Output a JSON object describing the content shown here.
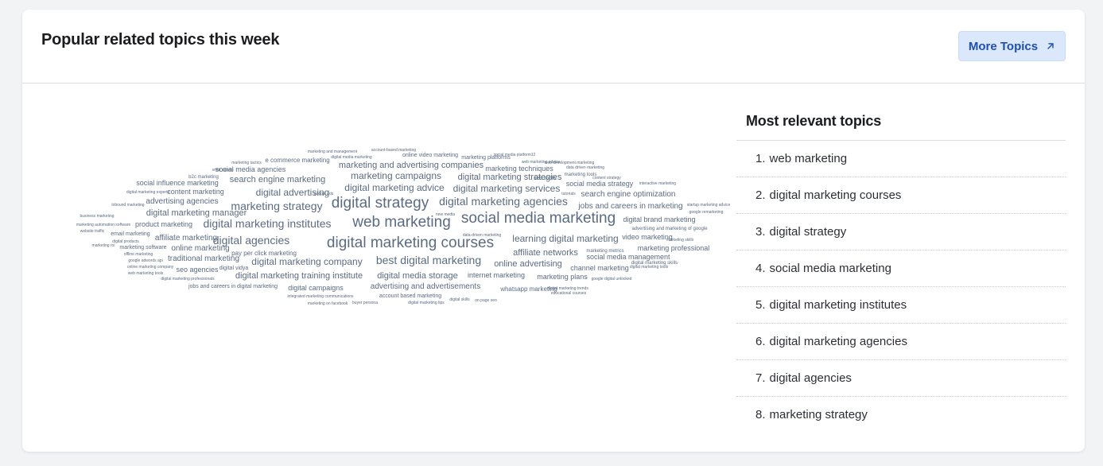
{
  "header": {
    "title": "Popular related topics this week",
    "more_button_label": "More Topics"
  },
  "cloud": {
    "color": "#5b6b82",
    "words": [
      {
        "text": "web marketing",
        "size": 19
      },
      {
        "text": "social media marketing",
        "size": 19
      },
      {
        "text": "digital strategy",
        "size": 19
      },
      {
        "text": "digital marketing courses",
        "size": 19
      },
      {
        "text": "digital marketing agencies",
        "size": 14
      },
      {
        "text": "marketing strategy",
        "size": 14
      },
      {
        "text": "digital marketing institutes",
        "size": 14
      },
      {
        "text": "digital agencies",
        "size": 14
      },
      {
        "text": "best digital marketing",
        "size": 14
      },
      {
        "text": "learning digital marketing",
        "size": 12
      },
      {
        "text": "digital marketing company",
        "size": 12
      },
      {
        "text": "digital advertising",
        "size": 12
      },
      {
        "text": "digital marketing advice",
        "size": 12
      },
      {
        "text": "digital marketing services",
        "size": 12
      },
      {
        "text": "search engine marketing",
        "size": 11
      },
      {
        "text": "marketing campaigns",
        "size": 12
      },
      {
        "text": "digital marketing strategies",
        "size": 11
      },
      {
        "text": "marketing and advertising companies",
        "size": 11
      },
      {
        "text": "affiliate networks",
        "size": 11
      },
      {
        "text": "online advertising",
        "size": 11
      },
      {
        "text": "digital marketing manager",
        "size": 11
      },
      {
        "text": "advertising agencies",
        "size": 10
      },
      {
        "text": "digital media storage",
        "size": 11
      },
      {
        "text": "jobs and careers in marketing",
        "size": 10
      },
      {
        "text": "search engine optimization",
        "size": 10
      },
      {
        "text": "digital marketing training institute",
        "size": 11
      },
      {
        "text": "traditional marketing",
        "size": 10
      },
      {
        "text": "online marketing",
        "size": 10
      },
      {
        "text": "affiliate marketing",
        "size": 10
      },
      {
        "text": "social media agencies",
        "size": 9
      },
      {
        "text": "content marketing",
        "size": 9
      },
      {
        "text": "social influence marketing",
        "size": 9
      },
      {
        "text": "social media strategy",
        "size": 9
      },
      {
        "text": "advertising and advertisements",
        "size": 10
      },
      {
        "text": "internet marketing",
        "size": 9
      },
      {
        "text": "marketing techniques",
        "size": 9
      },
      {
        "text": "digital brand marketing",
        "size": 9
      },
      {
        "text": "video marketing",
        "size": 9
      },
      {
        "text": "marketing professional",
        "size": 9
      },
      {
        "text": "social media management",
        "size": 9
      },
      {
        "text": "channel marketing",
        "size": 9
      },
      {
        "text": "marketing plans",
        "size": 9
      },
      {
        "text": "digital campaigns",
        "size": 9
      },
      {
        "text": "product marketing",
        "size": 9
      },
      {
        "text": "e commerce marketing",
        "size": 8
      },
      {
        "text": "seo agencies",
        "size": 9
      },
      {
        "text": "pay per click marketing",
        "size": 8
      },
      {
        "text": "whatsapp marketing",
        "size": 8
      },
      {
        "text": "account based marketing",
        "size": 7
      },
      {
        "text": "online video marketing",
        "size": 7
      },
      {
        "text": "marketing platforms",
        "size": 7
      },
      {
        "text": "digital marketing skills",
        "size": 6
      },
      {
        "text": "advertising and marketing of google",
        "size": 6
      },
      {
        "text": "jobs and careers in digital marketing",
        "size": 7
      },
      {
        "text": "marketing software",
        "size": 7
      },
      {
        "text": "seo tools",
        "size": 7
      },
      {
        "text": "email marketing",
        "size": 7
      },
      {
        "text": "digital vidya",
        "size": 7
      },
      {
        "text": "marketing tools",
        "size": 6
      },
      {
        "text": "marketing metrics",
        "size": 6
      },
      {
        "text": "b2c marketing",
        "size": 6
      },
      {
        "text": "marketing and management",
        "size": 5
      },
      {
        "text": "account-based marketing",
        "size": 5
      },
      {
        "text": "digital media marketing",
        "size": 5
      },
      {
        "text": "social media platform12",
        "size": 5
      },
      {
        "text": "marketing tactics",
        "size": 5
      },
      {
        "text": "web marketing advice",
        "size": 5
      },
      {
        "text": "web development marketing",
        "size": 5
      },
      {
        "text": "data driven marketing",
        "size": 5
      },
      {
        "text": "smm panels",
        "size": 5
      },
      {
        "text": "content strategy",
        "size": 5
      },
      {
        "text": "interactive marketing",
        "size": 5
      },
      {
        "text": "digital marketing experts",
        "size": 5
      },
      {
        "text": "google ads",
        "size": 5
      },
      {
        "text": "tutorials",
        "size": 5
      },
      {
        "text": "inbound marketing",
        "size": 5
      },
      {
        "text": "startup marketing advice",
        "size": 5
      },
      {
        "text": "business marketing",
        "size": 5
      },
      {
        "text": "new media",
        "size": 5
      },
      {
        "text": "google remarketing",
        "size": 5
      },
      {
        "text": "marketing automation software",
        "size": 5
      },
      {
        "text": "website traffic",
        "size": 5
      },
      {
        "text": "data-driven marketing",
        "size": 5
      },
      {
        "text": "digital products",
        "size": 5
      },
      {
        "text": "marketing skills",
        "size": 5
      },
      {
        "text": "marketing roi",
        "size": 5
      },
      {
        "text": "offline marketing",
        "size": 5
      },
      {
        "text": "google adwords api",
        "size": 5
      },
      {
        "text": "online marketing company",
        "size": 5
      },
      {
        "text": "web marketing tools",
        "size": 5
      },
      {
        "text": "digital marketing tools",
        "size": 5
      },
      {
        "text": "digital marketing professionals",
        "size": 5
      },
      {
        "text": "google digital unlocked",
        "size": 5
      },
      {
        "text": "digital marketing trends",
        "size": 5
      },
      {
        "text": "educational courses",
        "size": 5
      },
      {
        "text": "integrated marketing communications",
        "size": 5
      },
      {
        "text": "marketing on facebook",
        "size": 5
      },
      {
        "text": "buyer persona",
        "size": 5
      },
      {
        "text": "digital marketing tips",
        "size": 5
      },
      {
        "text": "digital skills",
        "size": 5
      },
      {
        "text": "on page seo",
        "size": 5
      }
    ]
  },
  "relevant": {
    "title": "Most relevant topics",
    "items": [
      {
        "num": "1.",
        "label": "web marketing"
      },
      {
        "num": "2.",
        "label": "digital marketing courses"
      },
      {
        "num": "3.",
        "label": "digital strategy"
      },
      {
        "num": "4.",
        "label": "social media marketing"
      },
      {
        "num": "5.",
        "label": "digital marketing institutes"
      },
      {
        "num": "6.",
        "label": "digital marketing agencies"
      },
      {
        "num": "7.",
        "label": "digital agencies"
      },
      {
        "num": "8.",
        "label": "marketing strategy"
      }
    ]
  },
  "colors": {
    "accent": "#1f4fb0",
    "button_bg": "#dbe7fb",
    "background": "#f2f3f5"
  }
}
